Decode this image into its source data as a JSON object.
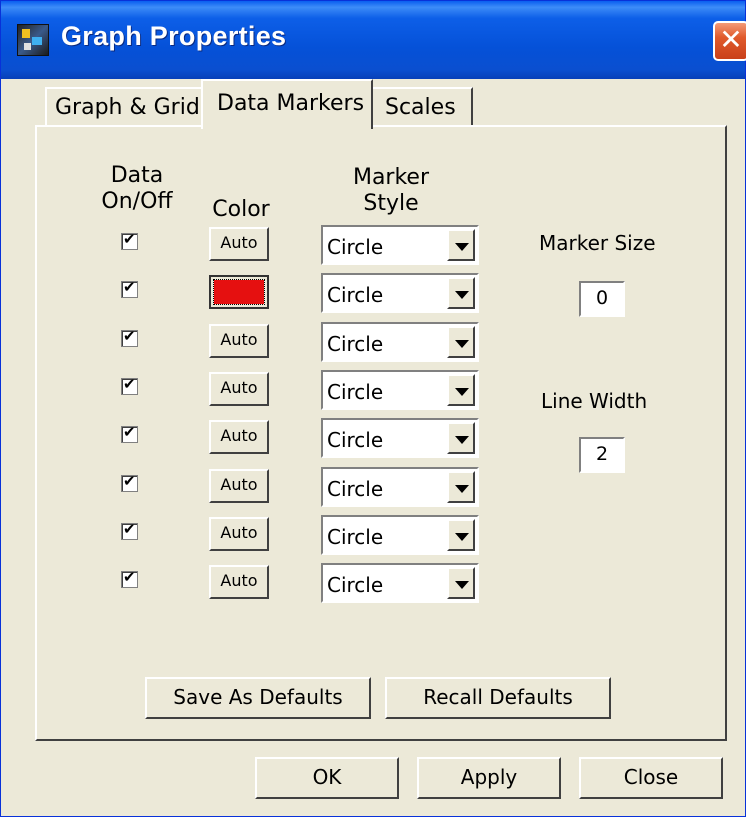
{
  "window": {
    "title": "Graph Properties",
    "close_glyph": "✕"
  },
  "icons": {
    "app": "graph-app-icon",
    "close": "close-icon",
    "check": "checkmark-icon",
    "dropdown": "chevron-down-icon"
  },
  "colors": {
    "titlebar": "#0a55e0",
    "dialog": "#ece9d8",
    "close": "#e05a2c",
    "marker_color_2": "#e51010"
  },
  "tabs": [
    {
      "label": "Graph & Grid",
      "active": false
    },
    {
      "label": "Data Markers",
      "active": true
    },
    {
      "label": "Scales",
      "active": false
    }
  ],
  "headers": {
    "data_line1": "Data",
    "data_line2": "On/Off",
    "color": "Color",
    "marker_line1": "Marker",
    "marker_line2": "Style"
  },
  "rows": [
    {
      "checked": true,
      "color_label": "Auto",
      "style": "Circle"
    },
    {
      "checked": true,
      "color_label": "",
      "style": "Circle"
    },
    {
      "checked": true,
      "color_label": "Auto",
      "style": "Circle"
    },
    {
      "checked": true,
      "color_label": "Auto",
      "style": "Circle"
    },
    {
      "checked": true,
      "color_label": "Auto",
      "style": "Circle"
    },
    {
      "checked": true,
      "color_label": "Auto",
      "style": "Circle"
    },
    {
      "checked": true,
      "color_label": "Auto",
      "style": "Circle"
    },
    {
      "checked": true,
      "color_label": "Auto",
      "style": "Circle"
    }
  ],
  "marker_size": {
    "label": "Marker Size",
    "value": "0"
  },
  "line_width": {
    "label": "Line Width",
    "value": "2"
  },
  "panel_buttons": {
    "save_defaults": "Save As Defaults",
    "recall_defaults": "Recall Defaults"
  },
  "footer_buttons": {
    "ok": "OK",
    "apply": "Apply",
    "close": "Close"
  }
}
